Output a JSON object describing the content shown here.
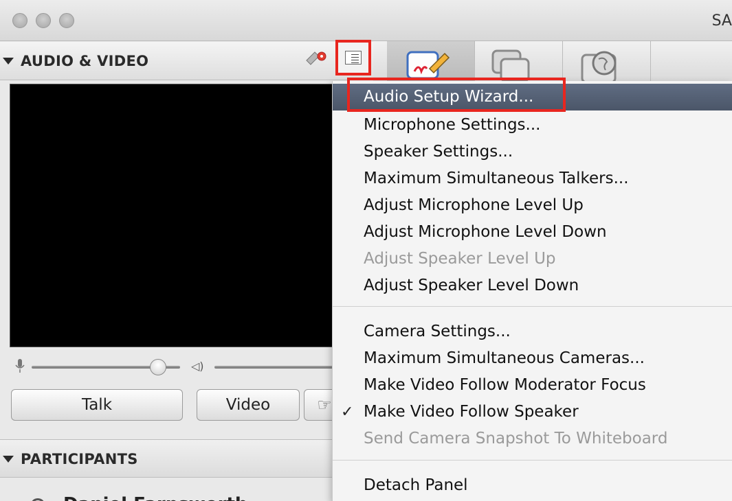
{
  "window": {
    "title_fragment": "SA"
  },
  "audio_video": {
    "title": "AUDIO & VIDEO",
    "buttons": {
      "talk": "Talk",
      "video": "Video"
    }
  },
  "participants": {
    "title": "PARTICIPANTS",
    "first_name": "Daniel Farnsworth"
  },
  "menu": {
    "group1": [
      {
        "label": "Audio Setup Wizard...",
        "state": "selected"
      },
      {
        "label": "Microphone Settings...",
        "state": "enabled"
      },
      {
        "label": "Speaker Settings...",
        "state": "enabled"
      },
      {
        "label": "Maximum Simultaneous Talkers...",
        "state": "enabled"
      },
      {
        "label": "Adjust Microphone Level Up",
        "state": "enabled"
      },
      {
        "label": "Adjust Microphone Level Down",
        "state": "enabled"
      },
      {
        "label": "Adjust Speaker Level Up",
        "state": "disabled"
      },
      {
        "label": "Adjust Speaker Level Down",
        "state": "enabled"
      }
    ],
    "group2": [
      {
        "label": "Camera Settings...",
        "state": "enabled"
      },
      {
        "label": "Maximum Simultaneous Cameras...",
        "state": "enabled"
      },
      {
        "label": "Make Video Follow Moderator Focus",
        "state": "enabled"
      },
      {
        "label": "Make Video Follow Speaker",
        "state": "checked"
      },
      {
        "label": "Send Camera Snapshot To Whiteboard",
        "state": "disabled"
      }
    ],
    "group3": [
      {
        "label": "Detach Panel",
        "state": "enabled"
      }
    ],
    "check_glyph": "✓"
  },
  "accent_colors": {
    "annotation_red": "#e8261f",
    "selected_menu": "#556075"
  }
}
